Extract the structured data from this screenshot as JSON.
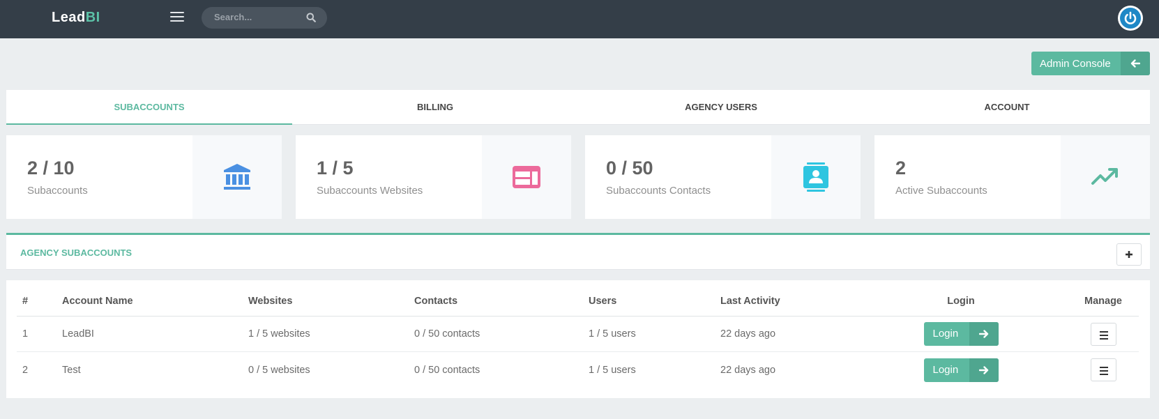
{
  "header": {
    "brand_main": "Lead",
    "brand_accent": "BI",
    "search_placeholder": "Search...",
    "icons": [
      "menu-icon",
      "search-icon",
      "power-icon"
    ]
  },
  "admin_console": {
    "label": "Admin Console",
    "icon": "arrow-left-icon"
  },
  "tabs": [
    {
      "label": "SUBACCOUNTS",
      "active": true
    },
    {
      "label": "BILLING",
      "active": false
    },
    {
      "label": "AGENCY USERS",
      "active": false
    },
    {
      "label": "ACCOUNT",
      "active": false
    }
  ],
  "stats": [
    {
      "value": "2 / 10",
      "label": "Subaccounts",
      "icon": "bank-icon",
      "color": "#4a90e2"
    },
    {
      "value": "1 / 5",
      "label": "Subaccounts Websites",
      "icon": "website-icon",
      "color": "#ec6a9b"
    },
    {
      "value": "0 / 50",
      "label": "Subaccounts Contacts",
      "icon": "contact-book-icon",
      "color": "#2ec5e0"
    },
    {
      "value": "2",
      "label": "Active Subaccounts",
      "icon": "trending-up-icon",
      "color": "#5cb9a0"
    }
  ],
  "section": {
    "title": "AGENCY SUBACCOUNTS",
    "add_icon": "plus-icon"
  },
  "table": {
    "columns": [
      "#",
      "Account Name",
      "Websites",
      "Contacts",
      "Users",
      "Last Activity",
      "Login",
      "Manage"
    ],
    "rows": [
      {
        "num": "1",
        "name": "LeadBI",
        "websites": "1 / 5 websites",
        "contacts": "0 / 50 contacts",
        "users": "1 / 5 users",
        "last_activity": "22 days ago",
        "login_label": "Login"
      },
      {
        "num": "2",
        "name": "Test",
        "websites": "0 / 5 websites",
        "contacts": "0 / 50 contacts",
        "users": "1 / 5 users",
        "last_activity": "22 days ago",
        "login_label": "Login"
      }
    ]
  },
  "colors": {
    "accent": "#5cb9a0",
    "topbar": "#343e48",
    "background": "#ebeef0",
    "power": "#1f88c6"
  }
}
